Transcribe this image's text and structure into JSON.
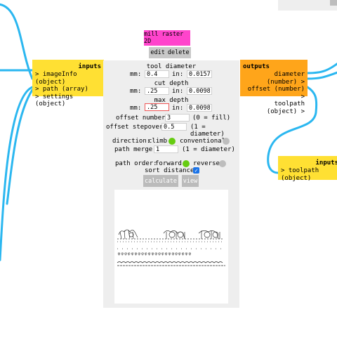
{
  "module": {
    "title": "mill raster 2D",
    "edit_label": "edit",
    "delete_label": "delete"
  },
  "inputs": {
    "header": "inputs",
    "ports": [
      "> imageInfo (object)",
      "> path (array)",
      "> settings (object)"
    ]
  },
  "outputs": {
    "header": "outputs",
    "ports": [
      "diameter (number) >",
      "offset (number) >",
      "toolpath (object) >"
    ]
  },
  "right_module": {
    "header": "inputs",
    "ports": [
      "> toolpath (object)"
    ]
  },
  "tool_diameter": {
    "title": "tool diameter",
    "mm_label": "mm:",
    "mm": "0.4",
    "in_label": "in:",
    "in": "0.01574"
  },
  "cut_depth": {
    "title": "cut depth",
    "mm_label": "mm:",
    "mm": ".25",
    "in_label": "in:",
    "in": "0.00984"
  },
  "max_depth": {
    "title": "max depth",
    "mm_label": "mm:",
    "mm": ".25",
    "in_label": "in:",
    "in": "0.00984"
  },
  "offset_number": {
    "label": "offset number:",
    "value": "3",
    "hint": "(0 = fill)"
  },
  "offset_stepover": {
    "label": "offset stepover:",
    "value": "0.5",
    "hint": "(1 = diameter)"
  },
  "direction": {
    "label": "direction:",
    "climb": "climb",
    "conventional": "conventional",
    "selected": "climb"
  },
  "path_merge": {
    "label": "path merge:",
    "value": "1",
    "hint": "(1 = diameter)"
  },
  "path_order": {
    "label": "path order:",
    "forward": "forward",
    "reverse": "reverse",
    "selected": "forward"
  },
  "sort_distance": {
    "label": "sort distance:",
    "checked": true
  },
  "buttons": {
    "calculate": "calculate",
    "view": "view"
  },
  "colors": {
    "wire": "#2bb7f0",
    "module_title": "#ff44cc",
    "inputs_bg": "#ffe033",
    "outputs_bg": "#ffa51a",
    "radio_on": "#66cc11",
    "radio_off": "#bdbdbd"
  }
}
